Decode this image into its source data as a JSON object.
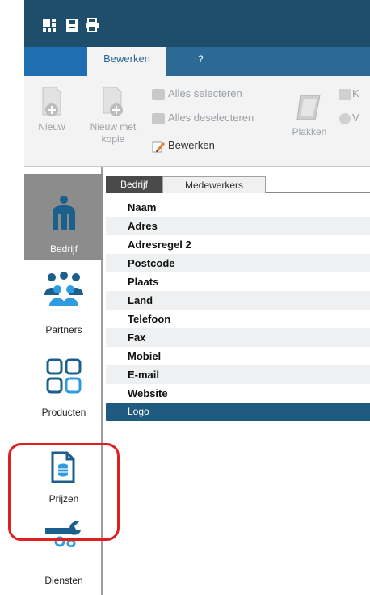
{
  "ribbon_tabs": {
    "active": "Bewerken",
    "help": "?"
  },
  "ribbon": {
    "nieuw": "Nieuw",
    "nieuw_met_kopie_1": "Nieuw met",
    "nieuw_met_kopie_2": "kopie",
    "alles_selecteren": "Alles selecteren",
    "alles_deselecteren": "Alles deselecteren",
    "bewerken": "Bewerken",
    "plakken": "Plakken",
    "clipped_1": "K",
    "clipped_2": "V"
  },
  "nav": {
    "bedrijf": "Bedrijf",
    "partners": "Partners",
    "producten": "Producten",
    "prijzen": "Prijzen",
    "diensten": "Diensten"
  },
  "subtabs": {
    "bedrijf": "Bedrijf",
    "medewerkers": "Medewerkers"
  },
  "fields": [
    "Naam",
    "Adres",
    "Adresregel 2",
    "Postcode",
    "Plaats",
    "Land",
    "Telefoon",
    "Fax",
    "Mobiel",
    "E-mail",
    "Website",
    "Logo"
  ],
  "colors": {
    "title_bar": "#1f4e6d",
    "tab_bar": "#2c6a95",
    "selection": "#1f5a80",
    "nav_icon": "#1b5f8c",
    "highlight": "#e02020"
  },
  "icons": [
    "grid-icon",
    "save-icon",
    "print-icon",
    "new-doc-icon",
    "copy-doc-icon",
    "select-all-icon",
    "deselect-all-icon",
    "edit-pencil-icon",
    "paste-icon",
    "company-icon",
    "partners-icon",
    "products-icon",
    "prices-icon",
    "services-icon"
  ]
}
